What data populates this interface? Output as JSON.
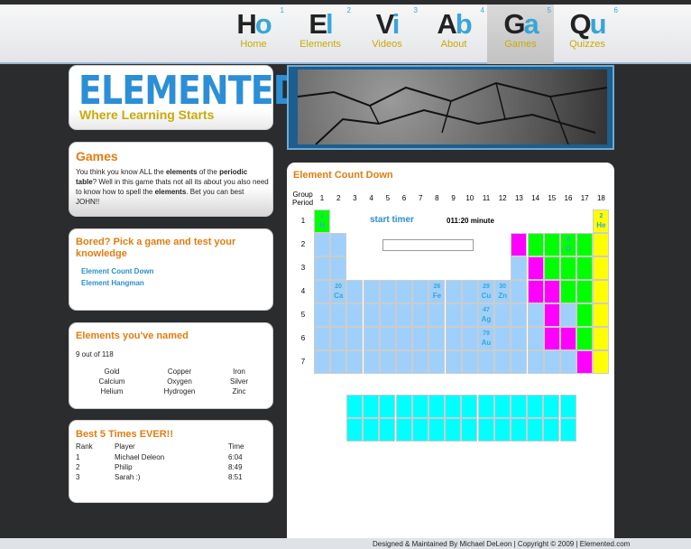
{
  "nav": [
    {
      "sym1": "H",
      "sym2": "o",
      "num": "1",
      "label": "Home"
    },
    {
      "sym1": "E",
      "sym2": "l",
      "num": "2",
      "label": "Elements"
    },
    {
      "sym1": "V",
      "sym2": "i",
      "num": "3",
      "label": "Videos"
    },
    {
      "sym1": "A",
      "sym2": "b",
      "num": "4",
      "label": "About"
    },
    {
      "sym1": "G",
      "sym2": "a",
      "num": "5",
      "label": "Games"
    },
    {
      "sym1": "Q",
      "sym2": "u",
      "num": "6",
      "label": "Quizzes"
    }
  ],
  "logo": {
    "title": "ELEMENTED",
    "tagline": "Where Learning Starts"
  },
  "games": {
    "title": "Games",
    "text_parts": [
      "You think you know ALL the ",
      "elements",
      " of the ",
      "periodic table",
      "? Well in this game thats not all its about you also need to know how to spell the ",
      "elements",
      ". Bet you can best JOHN!!"
    ]
  },
  "bored": {
    "title": "Bored? Pick a game and test your knowledge",
    "links": [
      "Element Count Down",
      "Element Hangman"
    ]
  },
  "named": {
    "title": "Elements you've named",
    "count": "9 out of 118",
    "items": [
      "Gold",
      "Copper",
      "Iron",
      "Calcium",
      "Oxygen",
      "Silver",
      "Helium",
      "Hydrogen",
      "Zinc"
    ]
  },
  "best": {
    "title": "Best 5 Times EVER!!",
    "headers": [
      "Rank",
      "Player",
      "Time"
    ],
    "rows": [
      [
        "1",
        "Michael Deleon",
        "6:04"
      ],
      [
        "2",
        "Philip",
        "8:49"
      ],
      [
        "3",
        "Sarah :)",
        "8:51"
      ]
    ]
  },
  "game": {
    "title": "Element Count Down",
    "group_label": "Group",
    "period_label": "Period",
    "groups": [
      "1",
      "2",
      "3",
      "4",
      "5",
      "6",
      "7",
      "8",
      "9",
      "10",
      "11",
      "12",
      "13",
      "14",
      "15",
      "16",
      "17",
      "18"
    ],
    "periods": [
      "1",
      "2",
      "3",
      "4",
      "5",
      "6",
      "7"
    ],
    "start_label": "start timer",
    "timer": "011:20 minute",
    "input_value": "",
    "named_elements": [
      {
        "num": "1",
        "sym": "H"
      },
      {
        "num": "2",
        "sym": "He"
      },
      {
        "num": "20",
        "sym": "Ca"
      },
      {
        "num": "26",
        "sym": "Fe"
      },
      {
        "num": "29",
        "sym": "Cu"
      },
      {
        "num": "30",
        "sym": "Zn"
      },
      {
        "num": "47",
        "sym": "Ag"
      },
      {
        "num": "79",
        "sym": "Au"
      },
      {
        "num": "8",
        "sym": "O"
      }
    ],
    "colors": {
      "blue": "#9fd0fb",
      "magenta": "#ff00ff",
      "green": "#00ff00",
      "yellow": "#ffff00",
      "cyan": "#00ffff"
    }
  },
  "footer": "Designed & Maintained By Michael DeLeon | Copyright © 2009 | Elemented.com"
}
